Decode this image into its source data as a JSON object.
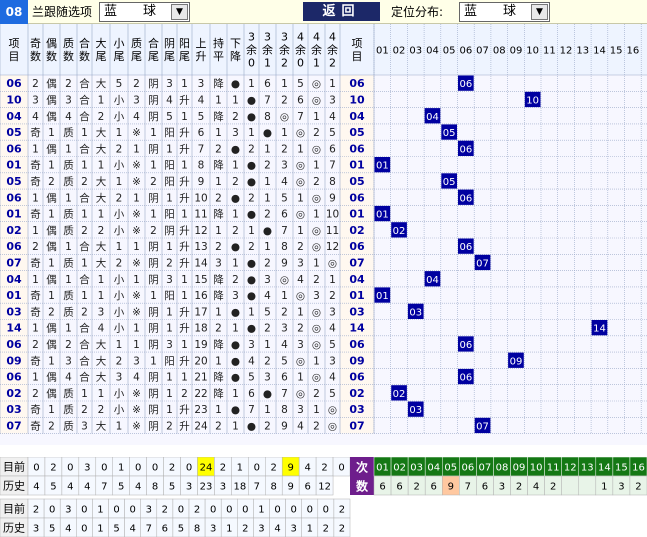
{
  "issue": "08",
  "follow_label": "兰跟随选项",
  "follow_value": "蓝　　球",
  "back_label": "返回",
  "pos_label": "定位分布:",
  "pos_value": "蓝　　球",
  "colors": {
    "blue": "#0000a0",
    "green": "#147814",
    "purple": "#6e1e8c",
    "yellow": "#ffff00",
    "peach": "#ffc8a0"
  },
  "headers_left": [
    "项目",
    "奇数",
    "偶数",
    "质数",
    "合数",
    "大尾",
    "小尾",
    "质尾",
    "合尾",
    "阴尾",
    "阳尾",
    "上升",
    "持平",
    "下降",
    "3余0",
    "3余1",
    "3余2",
    "4余0",
    "4余1",
    "4余2",
    "4余3",
    "5余0",
    "5余1",
    "5余2",
    "5余3",
    "5余4",
    "项目"
  ],
  "numbers": [
    "01",
    "02",
    "03",
    "04",
    "05",
    "06",
    "07",
    "08",
    "09",
    "10",
    "11",
    "12",
    "13",
    "14",
    "15",
    "16"
  ],
  "rows": [
    {
      "n": "06",
      "c": [
        "2",
        "偶",
        "2",
        "合",
        "大",
        "5",
        "2",
        "阴",
        "3",
        "1",
        "3",
        "降",
        "●",
        "1",
        "6",
        "1",
        "5",
        "◎",
        "1",
        "06"
      ]
    },
    {
      "n": "10",
      "c": [
        "3",
        "偶",
        "3",
        "合",
        "1",
        "小",
        "3",
        "阴",
        "4",
        "升",
        "4",
        "1",
        "1",
        "●",
        "7",
        "2",
        "6",
        "◎",
        "3",
        "10"
      ]
    },
    {
      "n": "04",
      "c": [
        "4",
        "偶",
        "4",
        "合",
        "2",
        "小",
        "4",
        "阴",
        "5",
        "1",
        "5",
        "降",
        "2",
        "●",
        "8",
        "◎",
        "7",
        "1",
        "4",
        "04"
      ]
    },
    {
      "n": "05",
      "c": [
        "奇",
        "1",
        "质",
        "1",
        "大",
        "1",
        "※",
        "1",
        "阳",
        "升",
        "6",
        "1",
        "3",
        "1",
        "●",
        "1",
        "◎",
        "2",
        "5",
        "05"
      ]
    },
    {
      "n": "06",
      "c": [
        "1",
        "偶",
        "1",
        "合",
        "大",
        "2",
        "1",
        "阴",
        "1",
        "升",
        "7",
        "2",
        "●",
        "2",
        "1",
        "2",
        "1",
        "◎",
        "6",
        "06"
      ]
    },
    {
      "n": "01",
      "c": [
        "奇",
        "1",
        "质",
        "1",
        "1",
        "小",
        "※",
        "1",
        "阳",
        "1",
        "8",
        "降",
        "1",
        "●",
        "2",
        "3",
        "◎",
        "1",
        "7",
        "01"
      ]
    },
    {
      "n": "05",
      "c": [
        "奇",
        "2",
        "质",
        "2",
        "大",
        "1",
        "※",
        "2",
        "阳",
        "升",
        "9",
        "1",
        "2",
        "●",
        "1",
        "4",
        "◎",
        "2",
        "8",
        "05"
      ]
    },
    {
      "n": "06",
      "c": [
        "1",
        "偶",
        "1",
        "合",
        "大",
        "2",
        "1",
        "阴",
        "1",
        "升",
        "10",
        "2",
        "●",
        "2",
        "1",
        "5",
        "1",
        "◎",
        "9",
        "06"
      ]
    },
    {
      "n": "01",
      "c": [
        "奇",
        "1",
        "质",
        "1",
        "1",
        "小",
        "※",
        "1",
        "阳",
        "1",
        "11",
        "降",
        "1",
        "●",
        "2",
        "6",
        "◎",
        "1",
        "10",
        "01"
      ]
    },
    {
      "n": "02",
      "c": [
        "1",
        "偶",
        "质",
        "2",
        "2",
        "小",
        "※",
        "2",
        "阴",
        "升",
        "12",
        "1",
        "2",
        "1",
        "●",
        "7",
        "1",
        "◎",
        "11",
        "02"
      ]
    },
    {
      "n": "06",
      "c": [
        "2",
        "偶",
        "1",
        "合",
        "大",
        "1",
        "1",
        "阴",
        "1",
        "升",
        "13",
        "2",
        "●",
        "2",
        "1",
        "8",
        "2",
        "◎",
        "12",
        "06"
      ]
    },
    {
      "n": "07",
      "c": [
        "奇",
        "1",
        "质",
        "1",
        "大",
        "2",
        "※",
        "阴",
        "2",
        "升",
        "14",
        "3",
        "1",
        "●",
        "2",
        "9",
        "3",
        "1",
        "◎",
        "07"
      ]
    },
    {
      "n": "04",
      "c": [
        "1",
        "偶",
        "1",
        "合",
        "1",
        "小",
        "1",
        "阴",
        "3",
        "1",
        "15",
        "降",
        "2",
        "●",
        "3",
        "◎",
        "4",
        "2",
        "1",
        "04"
      ]
    },
    {
      "n": "01",
      "c": [
        "奇",
        "1",
        "质",
        "1",
        "1",
        "小",
        "※",
        "1",
        "阳",
        "1",
        "16",
        "降",
        "3",
        "●",
        "4",
        "1",
        "◎",
        "3",
        "2",
        "01"
      ]
    },
    {
      "n": "03",
      "c": [
        "奇",
        "2",
        "质",
        "2",
        "3",
        "小",
        "※",
        "阴",
        "1",
        "升",
        "17",
        "1",
        "●",
        "1",
        "5",
        "2",
        "1",
        "◎",
        "3",
        "03"
      ]
    },
    {
      "n": "14",
      "c": [
        "1",
        "偶",
        "1",
        "合",
        "4",
        "小",
        "1",
        "阴",
        "1",
        "升",
        "18",
        "2",
        "1",
        "●",
        "2",
        "3",
        "2",
        "◎",
        "4",
        "14"
      ]
    },
    {
      "n": "06",
      "c": [
        "2",
        "偶",
        "2",
        "合",
        "大",
        "1",
        "1",
        "阴",
        "3",
        "1",
        "19",
        "降",
        "●",
        "3",
        "1",
        "4",
        "3",
        "◎",
        "5",
        "06"
      ]
    },
    {
      "n": "09",
      "c": [
        "奇",
        "1",
        "3",
        "合",
        "大",
        "2",
        "3",
        "1",
        "阳",
        "升",
        "20",
        "1",
        "●",
        "4",
        "2",
        "5",
        "◎",
        "1",
        "3",
        "09"
      ]
    },
    {
      "n": "06",
      "c": [
        "1",
        "偶",
        "4",
        "合",
        "大",
        "3",
        "4",
        "阴",
        "1",
        "1",
        "21",
        "降",
        "●",
        "5",
        "3",
        "6",
        "1",
        "◎",
        "4",
        "06"
      ]
    },
    {
      "n": "02",
      "c": [
        "2",
        "偶",
        "质",
        "1",
        "1",
        "小",
        "※",
        "阴",
        "1",
        "2",
        "22",
        "降",
        "1",
        "6",
        "●",
        "7",
        "◎",
        "2",
        "5",
        "02"
      ]
    },
    {
      "n": "03",
      "c": [
        "奇",
        "1",
        "质",
        "2",
        "2",
        "小",
        "※",
        "阴",
        "1",
        "升",
        "23",
        "1",
        "●",
        "7",
        "1",
        "8",
        "3",
        "1",
        "◎",
        "03"
      ]
    },
    {
      "n": "07",
      "c": [
        "奇",
        "2",
        "质",
        "3",
        "大",
        "1",
        "※",
        "阴",
        "2",
        "升",
        "24",
        "2",
        "1",
        "●",
        "2",
        "9",
        "4",
        "2",
        "◎",
        "07"
      ]
    }
  ],
  "stats_top": [
    {
      "label": "目前",
      "values": [
        "0",
        "2",
        "0",
        "3",
        "0",
        "1",
        "0",
        "0",
        "2",
        "0",
        "24",
        "2",
        "1",
        "0",
        "2",
        "9",
        "4",
        "2",
        "0"
      ]
    },
    {
      "label": "历史",
      "values": [
        "4",
        "5",
        "4",
        "4",
        "7",
        "5",
        "4",
        "8",
        "5",
        "3",
        "23",
        "3",
        "18",
        "7",
        "8",
        "9",
        "6",
        "12"
      ]
    }
  ],
  "freq_label": [
    "次",
    "数"
  ],
  "freq_numbers": [
    "01",
    "02",
    "03",
    "04",
    "05",
    "06",
    "07",
    "08",
    "09",
    "10",
    "11",
    "12",
    "13",
    "14",
    "15",
    "16"
  ],
  "freq_values": [
    "6",
    "6",
    "2",
    "6",
    "9",
    "7",
    "6",
    "3",
    "2",
    "4",
    "2",
    "",
    "",
    "1",
    "3",
    "2"
  ],
  "stats_bottom": [
    {
      "label": "目前",
      "values": [
        "2",
        "0",
        "3",
        "0",
        "1",
        "0",
        "0",
        "3",
        "2",
        "0",
        "2",
        "0",
        "0",
        "0",
        "1",
        "0",
        "0",
        "0",
        "0",
        "2"
      ]
    },
    {
      "label": "历史",
      "values": [
        "3",
        "5",
        "4",
        "0",
        "1",
        "5",
        "4",
        "7",
        "6",
        "5",
        "8",
        "3",
        "1",
        "2",
        "3",
        "4",
        "3",
        "1",
        "2",
        "2",
        "3"
      ]
    }
  ]
}
